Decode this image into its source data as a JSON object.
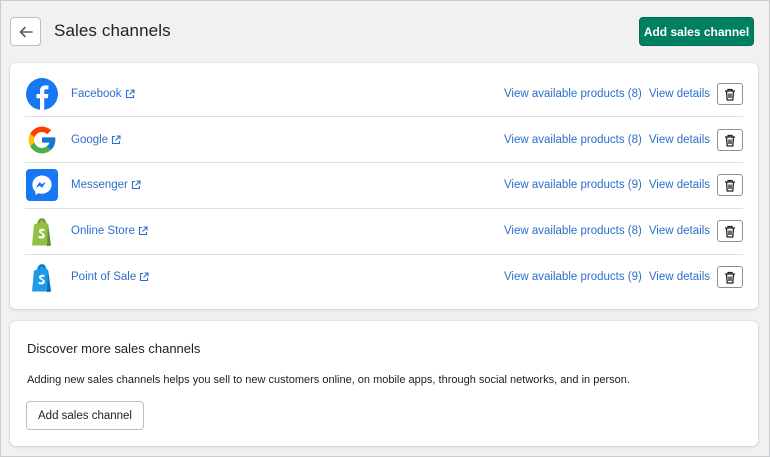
{
  "header": {
    "title": "Sales channels",
    "add_button_label": "Add sales channel"
  },
  "channels": [
    {
      "name": "Facebook",
      "icon": "facebook-logo",
      "products_label": "View available products (8)",
      "details_label": "View details"
    },
    {
      "name": "Google",
      "icon": "google-logo",
      "products_label": "View available products (8)",
      "details_label": "View details"
    },
    {
      "name": "Messenger",
      "icon": "messenger-logo",
      "products_label": "View available products (9)",
      "details_label": "View details"
    },
    {
      "name": "Online Store",
      "icon": "shopify-online-store-logo",
      "products_label": "View available products (8)",
      "details_label": "View details"
    },
    {
      "name": "Point of Sale",
      "icon": "shopify-pos-logo",
      "products_label": "View available products (9)",
      "details_label": "View details"
    }
  ],
  "discover": {
    "title": "Discover more sales channels",
    "description": "Adding new sales channels helps you sell to new customers online, on mobile apps, through social networks, and in person.",
    "button_label": "Add sales channel"
  },
  "colors": {
    "primary": "#008060",
    "link": "#2c6ecb",
    "background": "#f1f1f1"
  }
}
